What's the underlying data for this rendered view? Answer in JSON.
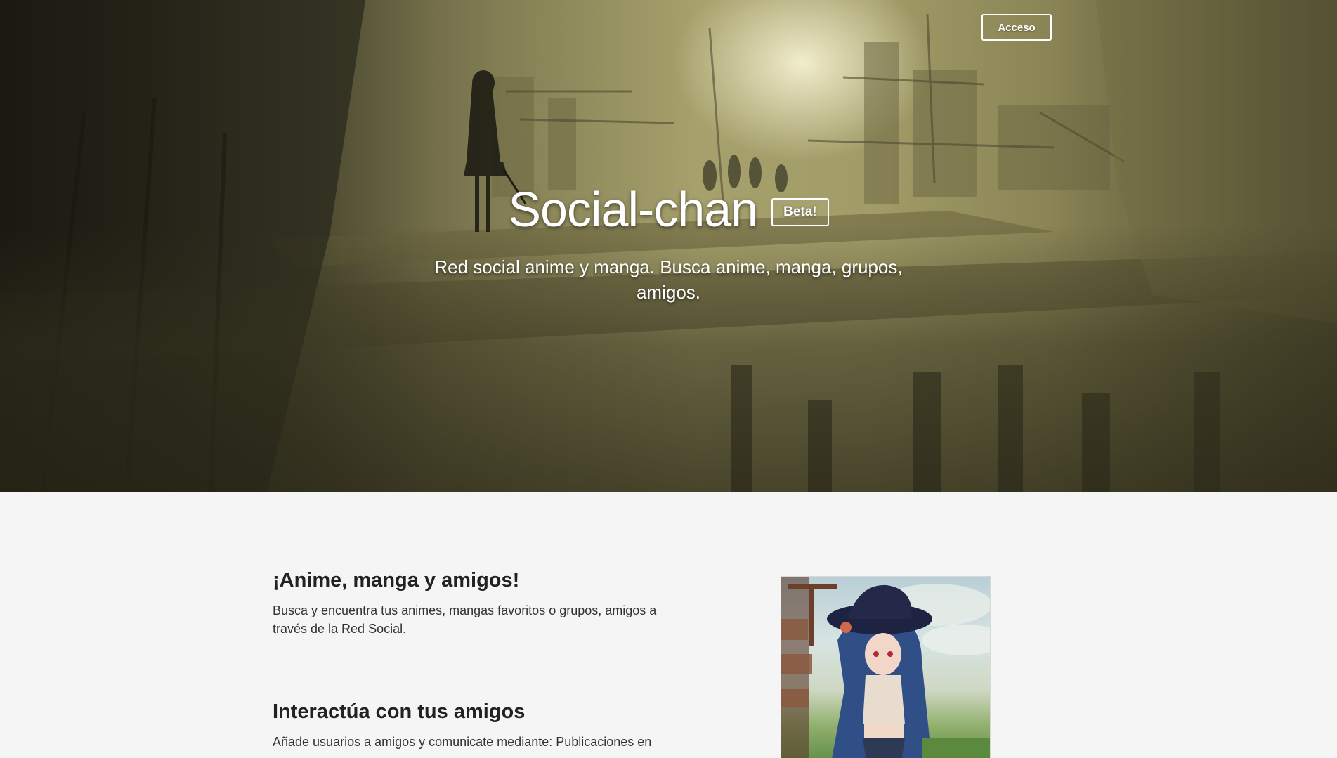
{
  "header": {
    "login_label": "Acceso"
  },
  "hero": {
    "title": "Social-chan",
    "badge": "Beta!",
    "subtitle": "Red social anime y manga. Busca anime, manga, grupos, amigos."
  },
  "features": [
    {
      "title": "¡Anime, manga y amigos!",
      "text": "Busca y encuentra tus animes, mangas favoritos o grupos, amigos a través de la Red Social."
    },
    {
      "title": "Interactúa con tus amigos",
      "text": "Añade usuarios a amigos y comunicate mediante: Publicaciones en"
    }
  ],
  "colors": {
    "content_background": "#f5f5f5",
    "heading_text": "#222222",
    "body_text": "#333333",
    "hero_text": "#ffffff"
  }
}
